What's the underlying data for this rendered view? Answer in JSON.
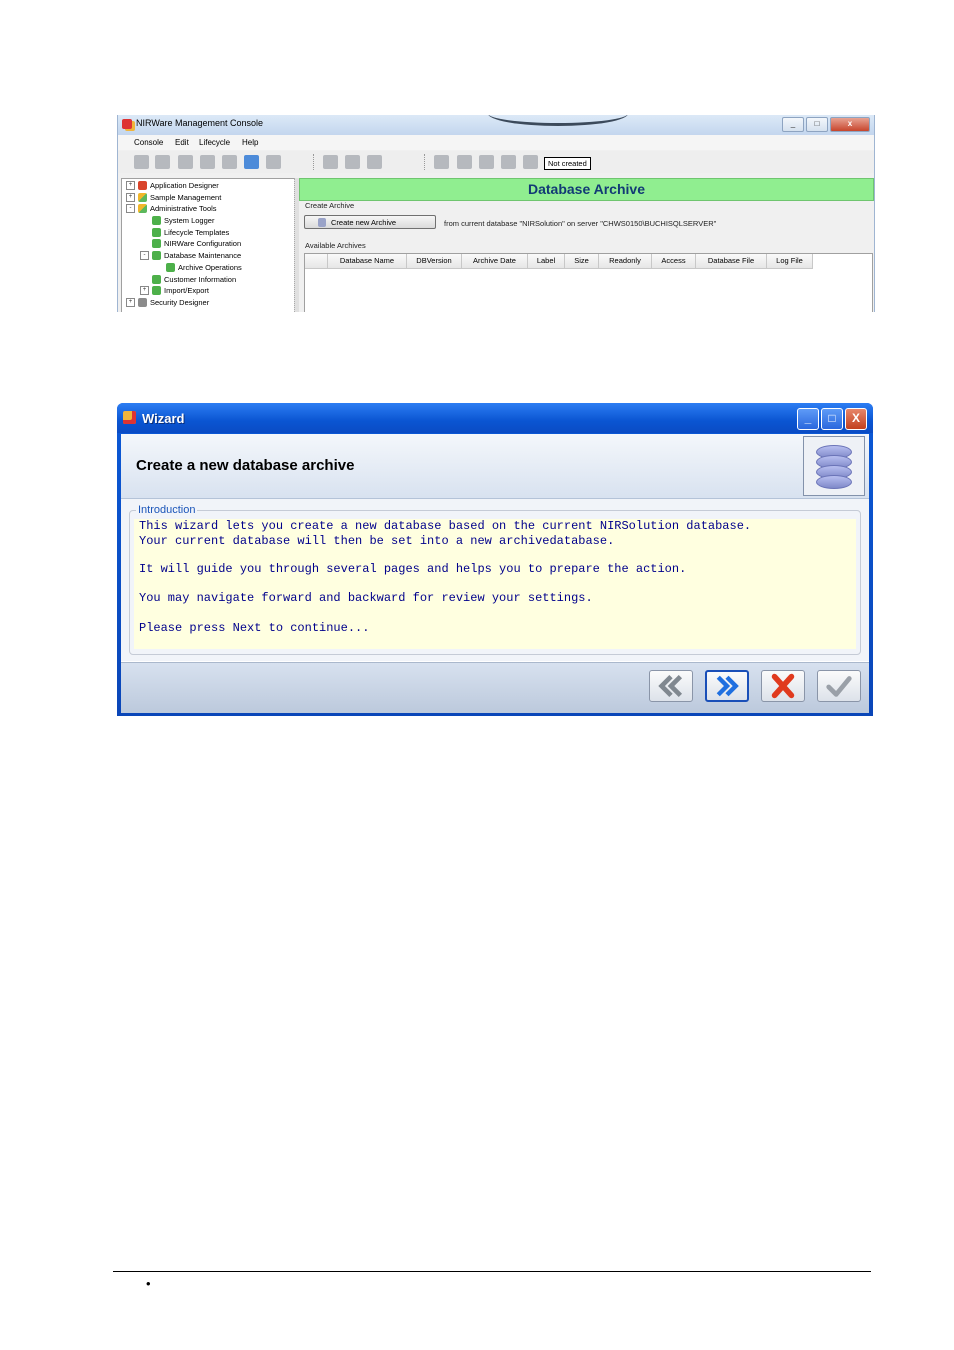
{
  "console": {
    "title": "NIRWare Management Console",
    "window_buttons": {
      "minimize": "_",
      "maximize": "□",
      "close": "x"
    },
    "menu": [
      "Console",
      "Edit",
      "Lifecycle",
      "Help"
    ],
    "status": "Not created",
    "tree": [
      {
        "label": "Application Designer",
        "icon": "puzzle-red",
        "expander": "+"
      },
      {
        "label": "Sample Management",
        "icon": "puzzle-multi",
        "expander": "+"
      },
      {
        "label": "Administrative Tools",
        "icon": "puzzle-multi",
        "expander": "-"
      },
      {
        "label": "System Logger",
        "icon": "puzzle-green",
        "expander": ""
      },
      {
        "label": "Lifecycle Templates",
        "icon": "puzzle-green",
        "expander": ""
      },
      {
        "label": "NIRWare Configuration",
        "icon": "puzzle-green",
        "expander": ""
      },
      {
        "label": "Database Maintenance",
        "icon": "puzzle-green",
        "expander": "-"
      },
      {
        "label": "Archive Operations",
        "icon": "puzzle-green",
        "expander": ""
      },
      {
        "label": "Customer Information",
        "icon": "puzzle-green",
        "expander": ""
      },
      {
        "label": "Import/Export",
        "icon": "puzzle-green",
        "expander": "+"
      },
      {
        "label": "Security Designer",
        "icon": "puzzle-gray",
        "expander": "+"
      }
    ],
    "panel_title": "Database Archive",
    "create_group_label": "Create Archive",
    "create_button": "Create new Archive",
    "archive_note": "from current database \"NIRSolution\" on server \"CHWS0150\\BUCHISQLSERVER\"",
    "available_label": "Available Archives",
    "columns": [
      "Database Name",
      "DBVersion",
      "Archive Date",
      "Label",
      "Size",
      "Readonly",
      "Access",
      "Database File",
      "Log File"
    ]
  },
  "wizard": {
    "title": "Wizard",
    "window_buttons": {
      "minimize": "_",
      "maximize": "□",
      "close": "X"
    },
    "heading": "Create a new database archive",
    "group_label": "Introduction",
    "lines": [
      "This wizard lets you create a new database based on the current NIRSolution database.",
      "Your current database will then be set into a new archivedatabase.",
      "It will guide you through several pages and helps you to prepare the action.",
      "You may navigate forward and backward for review your settings.",
      "Please press Next to continue..."
    ],
    "buttons": [
      "back-icon",
      "next-icon",
      "cancel-icon",
      "finish-icon"
    ],
    "colors": {
      "intro_text": "#00008b",
      "intro_bg": "#ffffe0",
      "header_band": "#90ee90"
    }
  },
  "page": {
    "bullet": "•"
  }
}
